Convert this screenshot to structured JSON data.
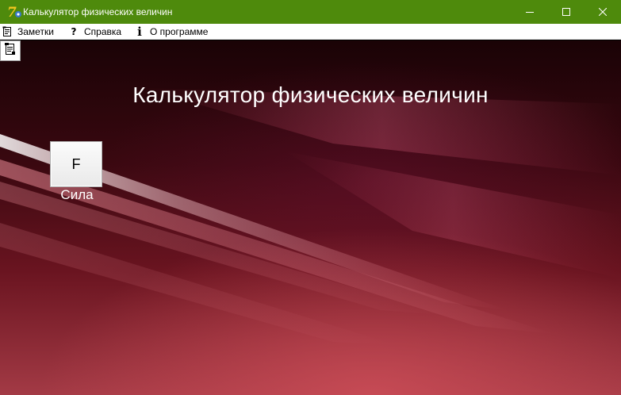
{
  "window": {
    "title": "Калькулятор физических величин",
    "icon": "app-logo-icon",
    "controls": [
      "minimize-icon",
      "maximize-icon",
      "close-icon"
    ],
    "titlebar_color": "#4e8a0c"
  },
  "menu": {
    "items": [
      {
        "label": "Заметки",
        "icon": "notes-icon"
      },
      {
        "label": "Справка",
        "icon": "help-icon",
        "glyph": "?"
      },
      {
        "label": "О программе",
        "icon": "info-icon",
        "glyph": "i"
      }
    ]
  },
  "toolbar": {
    "icon": "document-list-icon"
  },
  "main": {
    "heading": "Калькулятор физических величин",
    "quantities": [
      {
        "symbol": "F",
        "label": "Сила"
      }
    ]
  }
}
